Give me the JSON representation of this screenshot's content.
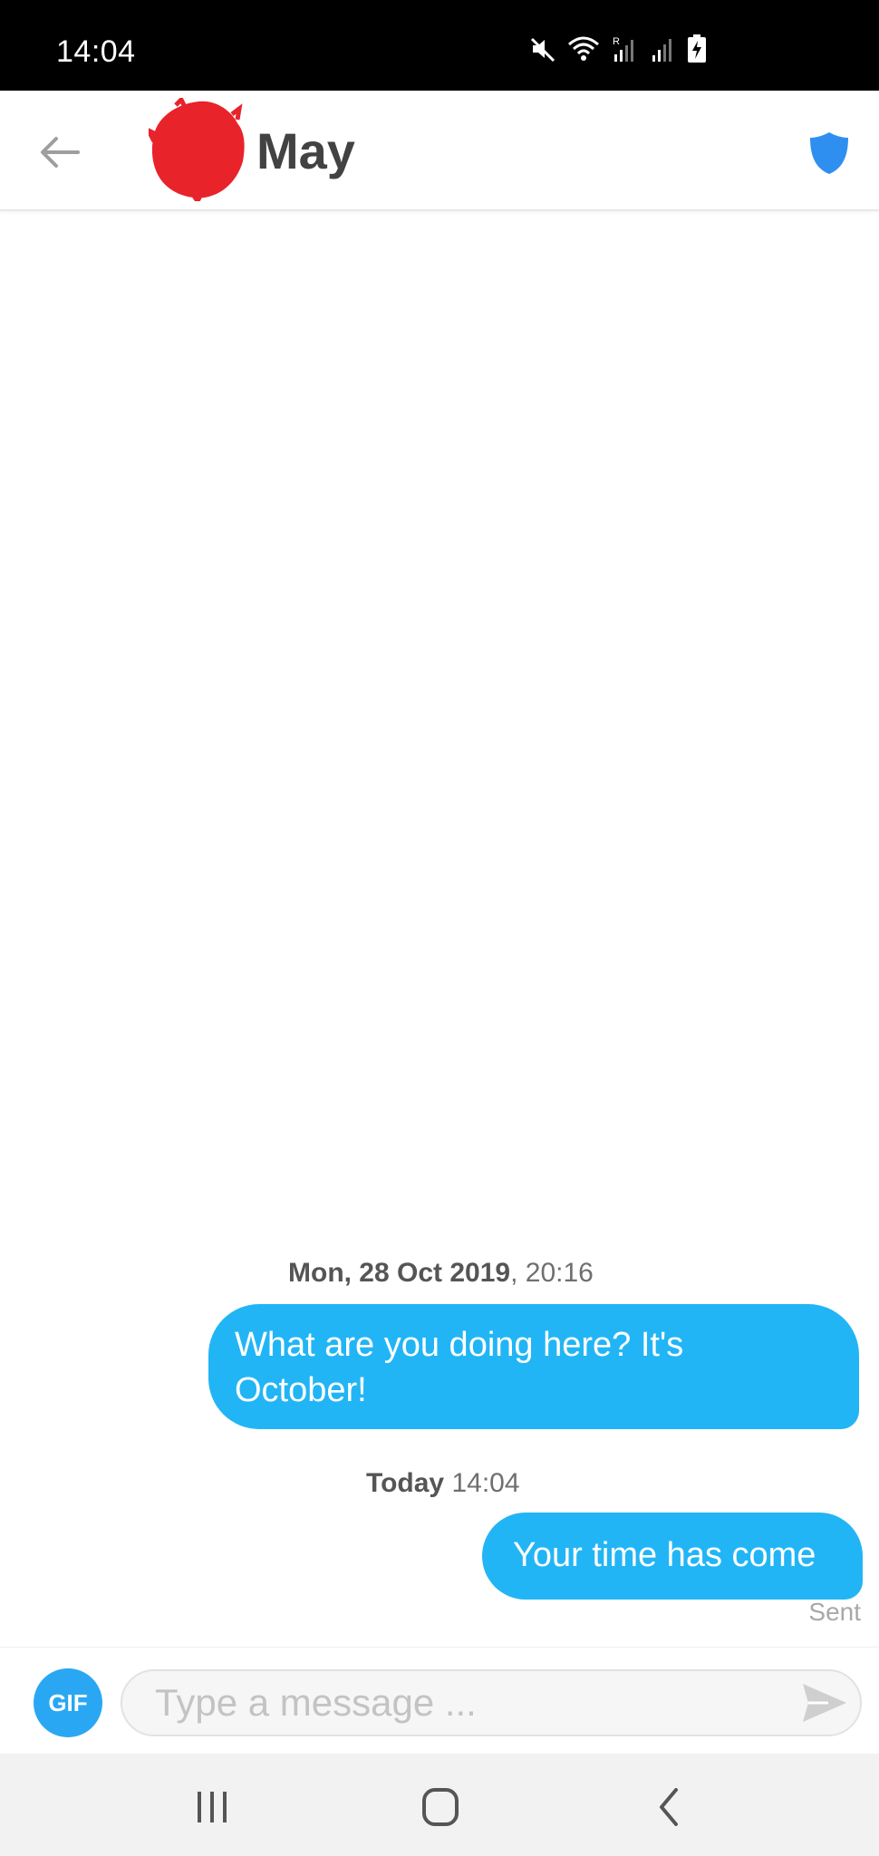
{
  "status_bar": {
    "time": "14:04",
    "icons": [
      "mute-icon",
      "wifi-icon",
      "signal-roaming-icon",
      "signal-icon",
      "battery-charging-icon"
    ]
  },
  "header": {
    "back_icon": "arrow-left-icon",
    "contact_name": "May",
    "safety_icon": "shield-icon",
    "avatar_color": "#e8232a",
    "shield_color": "#2f8ff0"
  },
  "thread": {
    "messages": [
      {
        "timestamp_bold": "Mon, 28 Oct 2019",
        "timestamp_rest": ", 20:16",
        "line1": "What are you doing here? It's",
        "line2": "October!"
      },
      {
        "timestamp_bold": "Today",
        "timestamp_rest": " 14:04",
        "text": "Your time has come",
        "status": "Sent"
      }
    ],
    "bubble_color": "#22b5f5"
  },
  "composer": {
    "gif_label": "GIF",
    "placeholder": "Type a message ...",
    "send_icon": "send-icon"
  },
  "nav_bar": {
    "icons": [
      "recents-icon",
      "home-icon",
      "back-icon"
    ]
  }
}
